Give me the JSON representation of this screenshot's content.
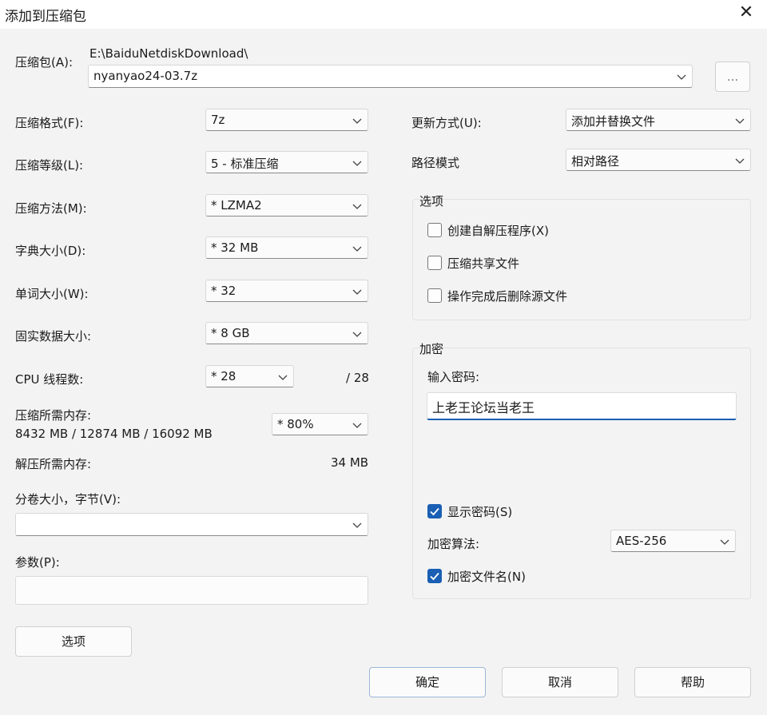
{
  "window": {
    "title": "添加到压缩包",
    "close_glyph": "✕"
  },
  "archive": {
    "label": "压缩包(A):",
    "path": "E:\\BaiduNetdiskDownload\\",
    "filename": "nyanyao24-03.7z",
    "browse_label": "..."
  },
  "left": {
    "format": {
      "label": "压缩格式(F):",
      "value": "7z"
    },
    "level": {
      "label": "压缩等级(L):",
      "value": "5 - 标准压缩"
    },
    "method": {
      "label": "压缩方法(M):",
      "value": "*  LZMA2"
    },
    "dict": {
      "label": "字典大小(D):",
      "value": "*  32 MB"
    },
    "word": {
      "label": "单词大小(W):",
      "value": "*  32"
    },
    "solid": {
      "label": "固实数据大小:",
      "value": "*  8 GB"
    },
    "threads": {
      "label": "CPU 线程数:",
      "value": "*  28",
      "max": "/ 28"
    },
    "mem_compress": {
      "label": "压缩所需内存:",
      "detail": "8432 MB / 12874 MB / 16092 MB",
      "value": "*  80%"
    },
    "mem_decompress": {
      "label": "解压所需内存:",
      "value": "34 MB"
    },
    "volume": {
      "label": "分卷大小，字节(V):",
      "value": ""
    },
    "params": {
      "label": "参数(P):",
      "value": ""
    },
    "options_button": "选项"
  },
  "right": {
    "update": {
      "label": "更新方式(U):",
      "value": "添加并替换文件"
    },
    "path_mode": {
      "label": "路径模式",
      "value": "相对路径"
    },
    "options_group": {
      "title": "选项",
      "items": [
        {
          "label": "创建自解压程序(X)",
          "checked": false
        },
        {
          "label": "压缩共享文件",
          "checked": false
        },
        {
          "label": "操作完成后删除源文件",
          "checked": false
        }
      ]
    },
    "encryption": {
      "title": "加密",
      "password_label": "输入密码:",
      "password_value": "上老王论坛当老王",
      "show_password": {
        "label": "显示密码(S)",
        "checked": true
      },
      "method_label": "加密算法:",
      "method_value": "AES-256",
      "encrypt_names": {
        "label": "加密文件名(N)",
        "checked": true
      }
    }
  },
  "footer": {
    "ok": "确定",
    "cancel": "取消",
    "help": "帮助"
  },
  "colors": {
    "accent": "#1a5fb4",
    "background": "#f3f3f3"
  }
}
